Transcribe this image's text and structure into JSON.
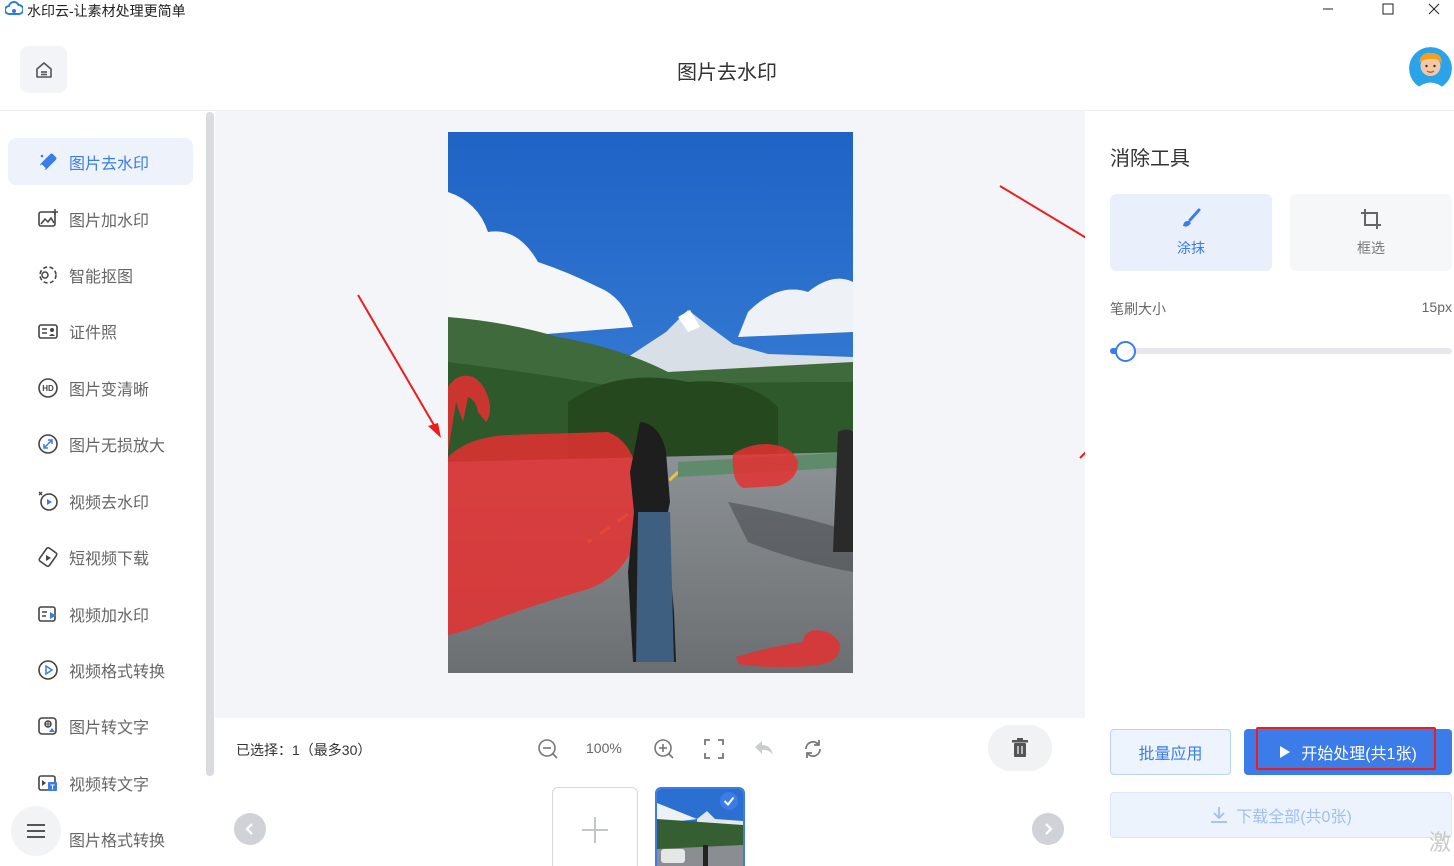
{
  "window": {
    "title": "水印云-让素材处理更简单",
    "logo_icon": "cloud-logo-icon"
  },
  "header": {
    "title": "图片去水印",
    "home_icon": "home-icon",
    "avatar_icon": "user-avatar"
  },
  "sidebar": {
    "active_index": 0,
    "items": [
      {
        "label": "图片去水印",
        "icon": "eraser-icon"
      },
      {
        "label": "图片加水印",
        "icon": "image-add-icon"
      },
      {
        "label": "智能抠图",
        "icon": "cutout-icon"
      },
      {
        "label": "证件照",
        "icon": "id-card-icon"
      },
      {
        "label": "图片变清晰",
        "icon": "hd-icon"
      },
      {
        "label": "图片无损放大",
        "icon": "enlarge-icon"
      },
      {
        "label": "视频去水印",
        "icon": "video-erase-icon"
      },
      {
        "label": "短视频下载",
        "icon": "download-video-icon"
      },
      {
        "label": "视频加水印",
        "icon": "video-add-icon"
      },
      {
        "label": "视频格式转换",
        "icon": "video-convert-icon"
      },
      {
        "label": "图片转文字",
        "icon": "image-text-icon"
      },
      {
        "label": "视频转文字",
        "icon": "video-text-icon"
      },
      {
        "label": "图片格式转换",
        "icon": "image-convert-icon"
      }
    ]
  },
  "toolbar": {
    "selected": "已选择：1（最多30）",
    "zoom": "100%"
  },
  "tools": {
    "title": "消除工具",
    "smear_label": "涂抹",
    "box_label": "框选",
    "brush_label": "笔刷大小",
    "brush_value": "15px"
  },
  "actions": {
    "batch": "批量应用",
    "start": "开始处理(共1张)",
    "download": "下载全部(共0张)"
  },
  "watermark_text": "激",
  "colors": {
    "accent": "#3b7ce8",
    "mask": "#e53030",
    "annotation": "#ee1c1c"
  }
}
